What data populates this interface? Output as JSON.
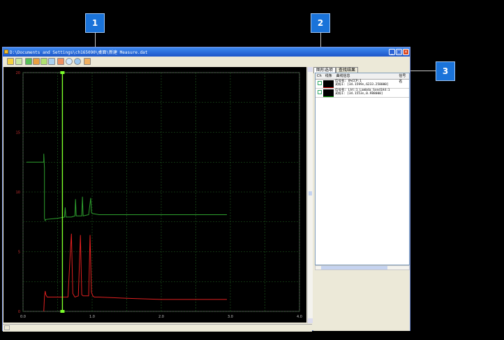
{
  "window": {
    "title": "D:\\Documents and Settings\\ch165090\\桌面\\新建 Measure.dat"
  },
  "callouts": [
    "1",
    "2",
    "3"
  ],
  "tabs": [
    {
      "label": "图形选项",
      "active": true
    },
    {
      "label": "查找结果",
      "active": false
    }
  ],
  "list": {
    "headers": [
      "Ch",
      "线条",
      "曲线信息",
      "信号名"
    ],
    "rows": [
      {
        "color": "#c00000",
        "line1": "信号名: 8%CCP:1",
        "line2": "光标1: [34.1599s,6233.258000]"
      },
      {
        "color": "#00a000",
        "line1": "信号名: Lht:1_Lambda_Sond1A4:1",
        "line2": "光标1: [34.1553s,0.988000]"
      }
    ]
  },
  "chart_data": {
    "type": "line",
    "xlim": [
      0,
      4
    ],
    "ylim": [
      0,
      20
    ],
    "xticks": [
      "0.0",
      "1.0",
      "2.0",
      "3.0",
      "4.0"
    ],
    "yticks": [
      "0",
      "5",
      "10",
      "15",
      "20"
    ],
    "ylabel": "",
    "grid": true,
    "cursor_x": 0.57,
    "series": [
      {
        "color": "#2ea02e",
        "x": [
          0.05,
          0.3,
          0.3,
          0.31,
          0.31,
          0.32,
          0.33,
          0.5,
          0.6,
          0.61,
          0.62,
          0.7,
          0.75,
          0.76,
          0.77,
          0.85,
          0.86,
          0.87,
          0.95,
          0.98,
          0.99,
          1.0,
          1.1,
          1.5,
          2.0,
          2.5,
          2.95
        ],
        "y": [
          12.5,
          12.5,
          13.2,
          12.0,
          7.8,
          7.6,
          7.7,
          7.8,
          7.9,
          8.7,
          7.9,
          7.9,
          8.0,
          9.4,
          8.0,
          8.0,
          9.6,
          8.0,
          8.1,
          9.5,
          8.3,
          8.2,
          8.1,
          8.1,
          8.1,
          8.1,
          8.1
        ]
      },
      {
        "color": "#e02020",
        "x": [
          0.3,
          0.31,
          0.32,
          0.33,
          0.35,
          0.6,
          0.65,
          0.68,
          0.7,
          0.72,
          0.75,
          0.8,
          0.83,
          0.85,
          0.87,
          0.9,
          0.95,
          0.97,
          0.99,
          1.01,
          1.03,
          1.1,
          1.5,
          2.0,
          2.5,
          2.95
        ],
        "y": [
          0,
          1.2,
          1.7,
          1.4,
          1.2,
          1.2,
          1.2,
          4.5,
          6.5,
          1.5,
          1.2,
          1.3,
          6.4,
          1.4,
          1.3,
          1.3,
          1.3,
          6.4,
          1.6,
          1.3,
          1.2,
          1.2,
          1.1,
          1.0,
          1.0,
          1.0
        ]
      }
    ]
  }
}
